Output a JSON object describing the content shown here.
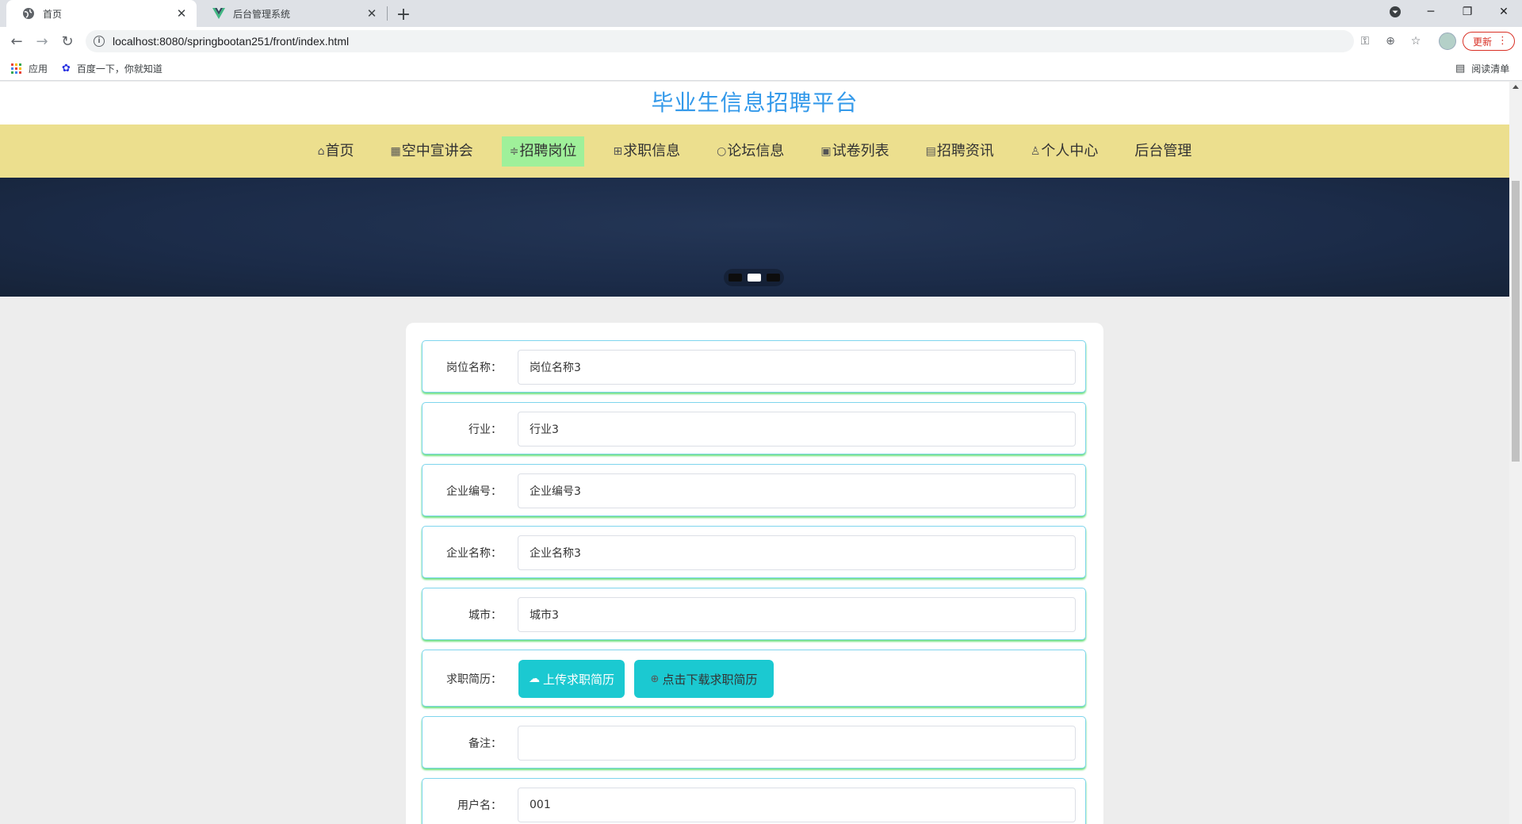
{
  "browser": {
    "tabs": [
      {
        "title": "首页",
        "active": true
      },
      {
        "title": "后台管理系统",
        "active": false
      }
    ],
    "url": "localhost:8080/springbootan251/front/index.html",
    "update_label": "更新",
    "bookmarks": [
      {
        "label": "应用"
      },
      {
        "label": "百度一下，你就知道"
      }
    ],
    "reading_list_label": "阅读清单"
  },
  "site": {
    "title": "毕业生信息招聘平台",
    "nav": [
      {
        "icon": "⌂",
        "label": "首页",
        "active": false
      },
      {
        "icon": "▦",
        "label": "空中宣讲会",
        "active": false
      },
      {
        "icon": "≑",
        "label": "招聘岗位",
        "active": true
      },
      {
        "icon": "⊞",
        "label": "求职信息",
        "active": false
      },
      {
        "icon": "○",
        "label": "论坛信息",
        "active": false
      },
      {
        "icon": "▣",
        "label": "试卷列表",
        "active": false
      },
      {
        "icon": "▤",
        "label": "招聘资讯",
        "active": false
      },
      {
        "icon": "♙",
        "label": "个人中心",
        "active": false
      },
      {
        "icon": "",
        "label": "后台管理",
        "active": false
      }
    ],
    "carousel": {
      "slide_count": 3,
      "active_index": 1
    }
  },
  "form": {
    "fields": [
      {
        "label": "岗位名称：",
        "value": "岗位名称3"
      },
      {
        "label": "行业：",
        "value": "行业3"
      },
      {
        "label": "企业编号：",
        "value": "企业编号3"
      },
      {
        "label": "企业名称：",
        "value": "企业名称3"
      },
      {
        "label": "城市：",
        "value": "城市3"
      }
    ],
    "resume": {
      "label": "求职简历：",
      "upload_label": "上传求职简历",
      "download_label": "点击下载求职简历"
    },
    "remark": {
      "label": "备注：",
      "value": ""
    },
    "username": {
      "label": "用户名：",
      "value": "001"
    }
  },
  "colors": {
    "title_blue": "#3399ea",
    "nav_bg": "#ecdf8e",
    "nav_active": "#9ff09a",
    "banner_bg": "#1b2b48",
    "teal_button": "#1bc9d1",
    "row_border": "#7fd5ee",
    "row_shadow": "#68e07a"
  }
}
